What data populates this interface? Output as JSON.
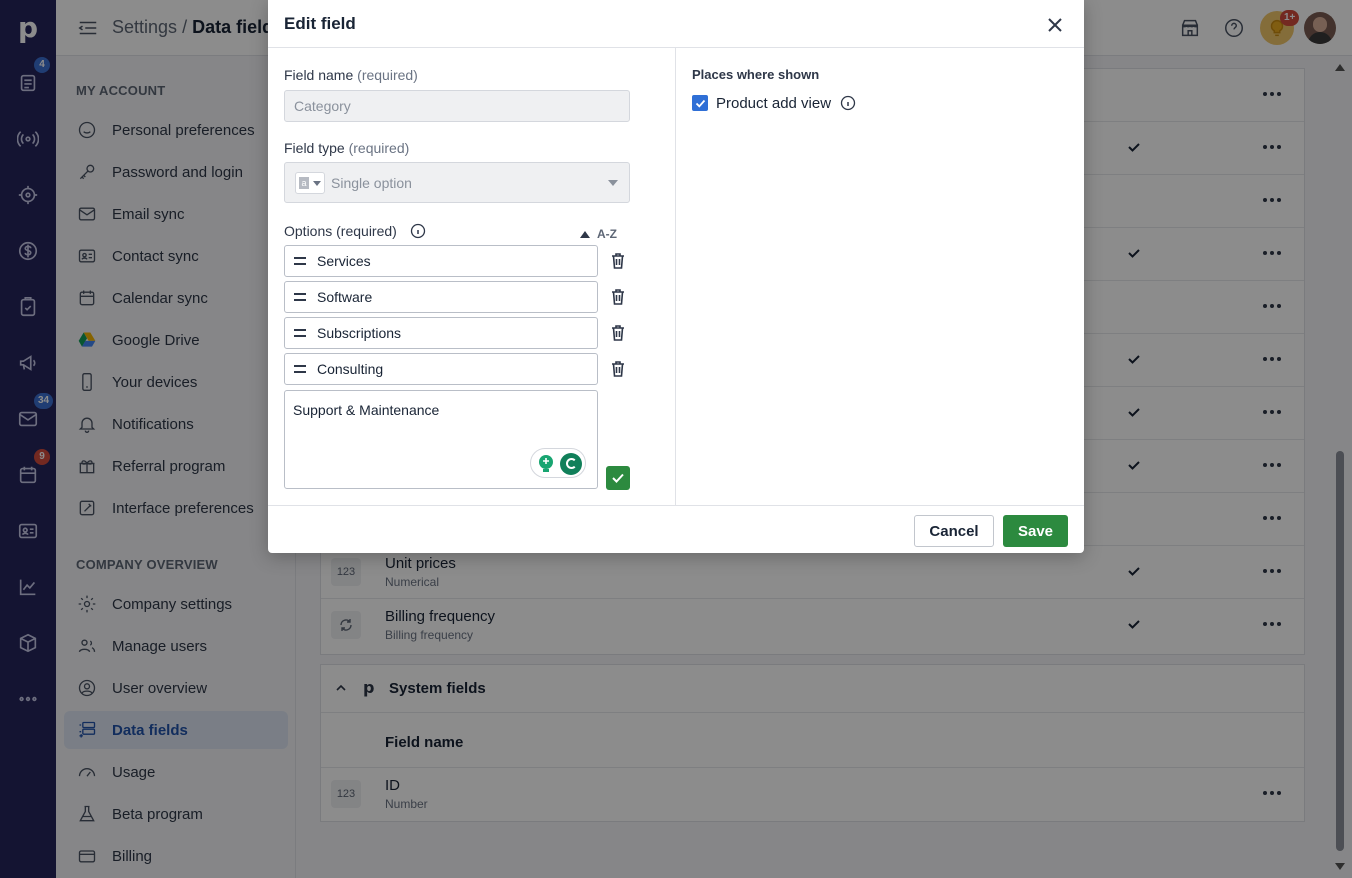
{
  "colors": {
    "rail": "#26265c",
    "accent": "#2153aa",
    "save": "#2c8a3f",
    "badge_blue": "#3b6fd1",
    "badge_red": "#d24b3d"
  },
  "rail": {
    "logo": "p",
    "badges": {
      "deals": "4",
      "mail": "34",
      "calendar": "9"
    }
  },
  "breadcrumb": {
    "parent": "Settings",
    "separator": "/",
    "current": "Data fields"
  },
  "topbar": {
    "notif_badge": "1+"
  },
  "sidebar": {
    "my_account_heading": "MY ACCOUNT",
    "my_account": [
      {
        "label": "Personal preferences"
      },
      {
        "label": "Password and login"
      },
      {
        "label": "Email sync"
      },
      {
        "label": "Contact sync"
      },
      {
        "label": "Calendar sync"
      },
      {
        "label": "Google Drive"
      },
      {
        "label": "Your devices"
      },
      {
        "label": "Notifications"
      },
      {
        "label": "Referral program"
      },
      {
        "label": "Interface preferences"
      }
    ],
    "company_heading": "COMPANY OVERVIEW",
    "company": [
      {
        "label": "Company settings"
      },
      {
        "label": "Manage users"
      },
      {
        "label": "User overview"
      },
      {
        "label": "Data fields"
      },
      {
        "label": "Usage"
      },
      {
        "label": "Beta program"
      },
      {
        "label": "Billing"
      }
    ]
  },
  "main": {
    "product_rows": [
      {
        "name": "Unit prices",
        "type": "Numerical",
        "type_icon": "123"
      },
      {
        "name": "Billing frequency",
        "type": "Billing frequency",
        "type_icon": "sync"
      }
    ],
    "system_fields": {
      "title": "System fields",
      "column_header": "Field name",
      "rows": [
        {
          "name": "ID",
          "type": "Number",
          "type_icon": "123"
        }
      ]
    }
  },
  "modal": {
    "title": "Edit field",
    "field_name_label": "Field name",
    "field_name_req": "(required)",
    "field_name_value": "Category",
    "field_type_label": "Field type",
    "field_type_req": "(required)",
    "field_type_value": "Single option",
    "options_label": "Options (required)",
    "sort_label": "A-Z",
    "options": [
      {
        "label": "Services"
      },
      {
        "label": "Software"
      },
      {
        "label": "Subscriptions"
      },
      {
        "label": "Consulting"
      }
    ],
    "new_option_value": "Support & Maintenance",
    "places_heading": "Places where shown",
    "places": [
      {
        "label": "Product add view",
        "checked": true
      }
    ],
    "cancel_label": "Cancel",
    "save_label": "Save"
  }
}
